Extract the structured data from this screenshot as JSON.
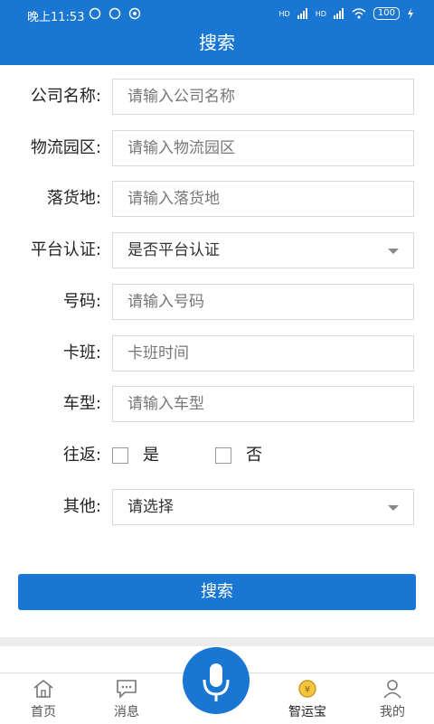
{
  "status_bar": {
    "time": "晚上11:53",
    "signal1": "HD",
    "signal2": "HD",
    "battery": "100"
  },
  "header": {
    "title": "搜索"
  },
  "form": {
    "company": {
      "label": "公司名称:",
      "placeholder": "请输入公司名称"
    },
    "park": {
      "label": "物流园区:",
      "placeholder": "请输入物流园区"
    },
    "destination": {
      "label": "落货地:",
      "placeholder": "请输入落货地"
    },
    "platform": {
      "label": "平台认证:",
      "value": "是否平台认证"
    },
    "number": {
      "label": "号码:",
      "placeholder": "请输入号码"
    },
    "shift": {
      "label": "卡班:",
      "placeholder": "卡班时间"
    },
    "vehicle": {
      "label": "车型:",
      "placeholder": "请输入车型"
    },
    "round_trip": {
      "label": "往返:",
      "yes": "是",
      "no": "否"
    },
    "other": {
      "label": "其他:",
      "value": "请选择"
    }
  },
  "search_button": {
    "label": "搜索"
  },
  "tabbar": {
    "home": "首页",
    "messages": "消息",
    "zhiyunbao": "智运宝",
    "mine": "我的"
  },
  "colors": {
    "primary": "#1976d2"
  }
}
